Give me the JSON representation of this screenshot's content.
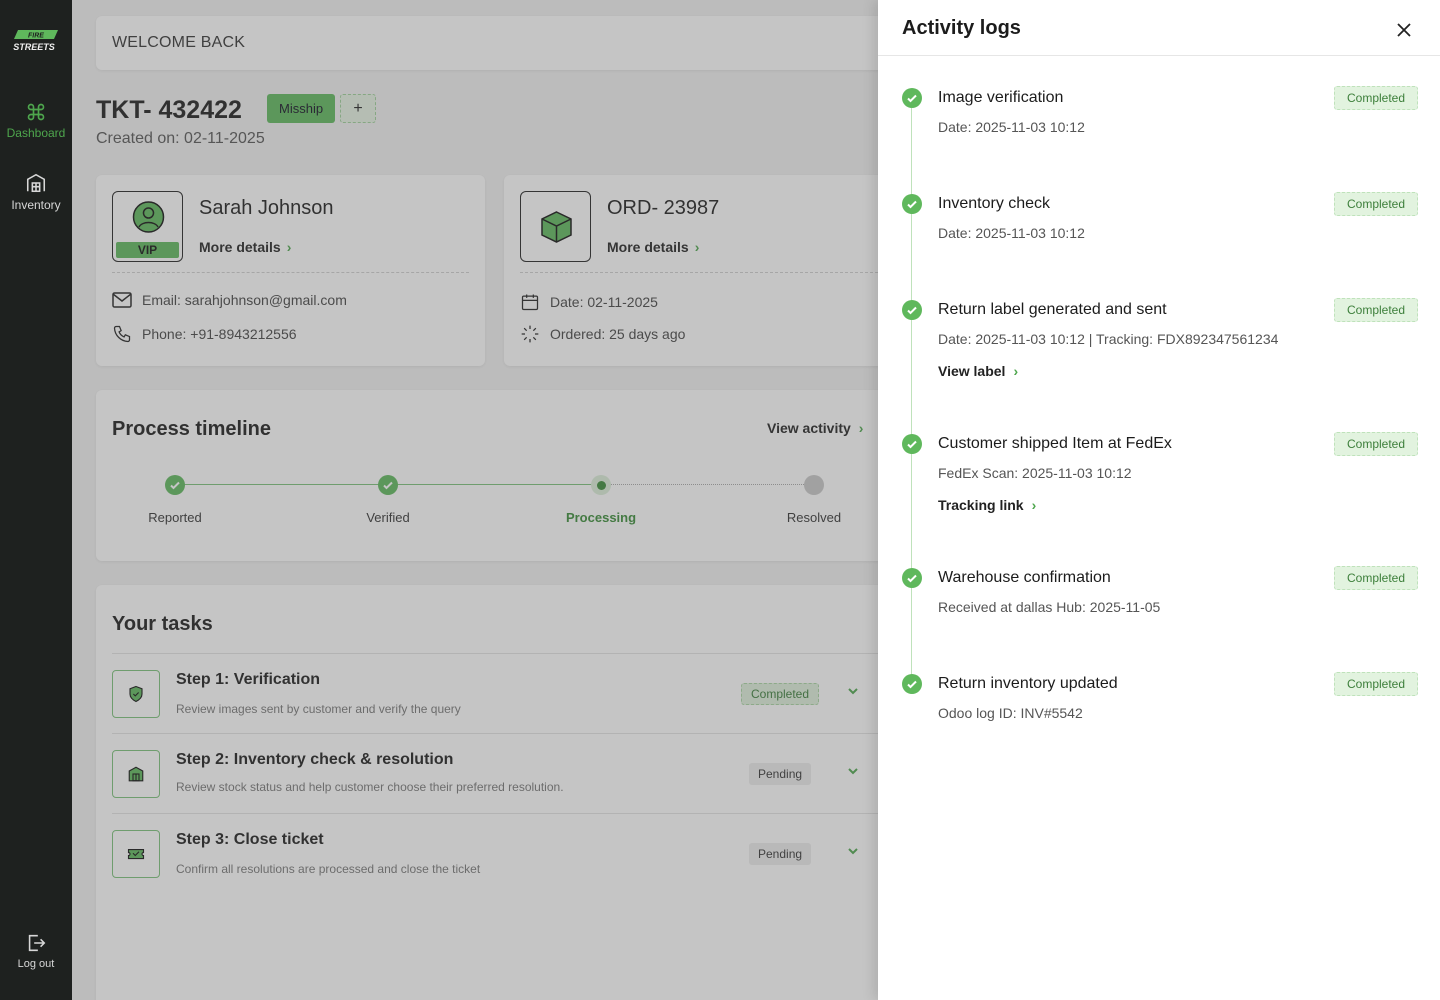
{
  "brand": {
    "logo_alt": "STREETS"
  },
  "sidebar": {
    "items": [
      {
        "label": "Dashboard",
        "icon": "command-icon"
      },
      {
        "label": "Inventory",
        "icon": "warehouse-icon"
      }
    ],
    "logout": {
      "label": "Log out",
      "icon": "logout-icon"
    }
  },
  "header": {
    "welcome": "WELCOME BACK"
  },
  "ticket": {
    "id": "TKT- 432422",
    "tag": "Misship",
    "add_label": "+",
    "created": "Created on: 02-11-2025"
  },
  "customer": {
    "name": "Sarah Johnson",
    "badge": "VIP",
    "more": "More details",
    "email": "Email: sarahjohnson@gmail.com",
    "phone": "Phone: +91-8943212556"
  },
  "order": {
    "id": "ORD- 23987",
    "more": "More details",
    "date": "Date: 02-11-2025",
    "ordered": "Ordered: 25 days ago"
  },
  "timeline": {
    "title": "Process timeline",
    "view_activity": "View activity",
    "steps": [
      {
        "label": "Reported",
        "state": "done"
      },
      {
        "label": "Verified",
        "state": "done"
      },
      {
        "label": "Processing",
        "state": "current"
      },
      {
        "label": "Resolved",
        "state": "upcoming"
      }
    ]
  },
  "tasks": {
    "title": "Your tasks",
    "items": [
      {
        "title": "Step 1: Verification",
        "desc": "Review images sent by customer and verify the query",
        "status": "Completed"
      },
      {
        "title": "Step 2: Inventory check & resolution",
        "desc": "Review stock status and help customer choose their preferred resolution.",
        "status": "Pending"
      },
      {
        "title": "Step 3: Close ticket",
        "desc": "Confirm all resolutions are processed and close the ticket",
        "status": "Pending"
      }
    ]
  },
  "drawer": {
    "title": "Activity logs",
    "logs": [
      {
        "title": "Image verification",
        "meta": "Date: 2025-11-03 10:12",
        "status": "Completed"
      },
      {
        "title": "Inventory check",
        "meta": "Date: 2025-11-03 10:12",
        "status": "Completed"
      },
      {
        "title": "Return label generated and sent",
        "meta": "Date: 2025-11-03 10:12 | Tracking: FDX892347561234",
        "link": "View label",
        "status": "Completed"
      },
      {
        "title": "Customer shipped Item at FedEx",
        "meta": "FedEx Scan: 2025-11-03 10:12",
        "link": "Tracking link",
        "status": "Completed"
      },
      {
        "title": "Warehouse confirmation",
        "meta": "Received at dallas Hub: 2025-11-05",
        "status": "Completed"
      },
      {
        "title": "Return inventory updated",
        "meta": "Odoo log ID: INV#5542",
        "status": "Completed"
      }
    ]
  },
  "colors": {
    "accent": "#5fb85c",
    "sidebar_bg": "#1e211f",
    "overlay": "#5a5a5a"
  }
}
